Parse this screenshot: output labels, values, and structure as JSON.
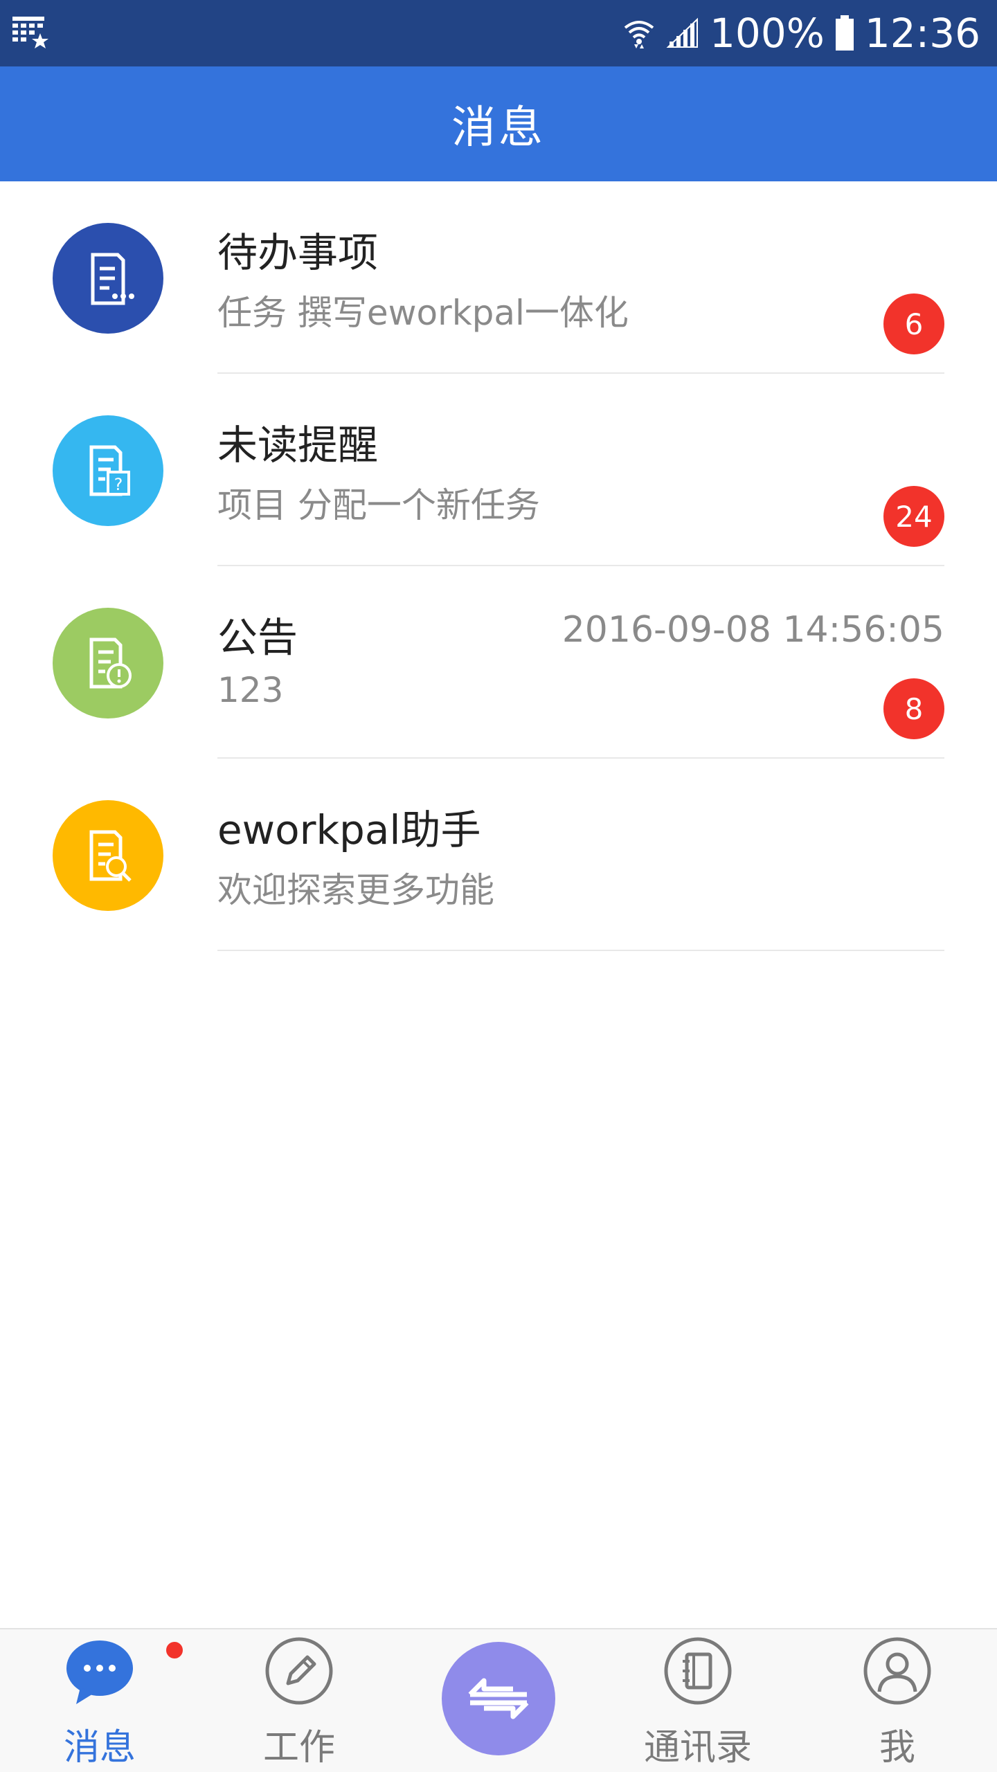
{
  "status_bar": {
    "battery": "100%",
    "time": "12:36"
  },
  "header": {
    "title": "消息"
  },
  "messages": [
    {
      "name": "待办事项",
      "preview": "任务 撰写eworkpal一体化",
      "time": "",
      "badge": "6",
      "color": "#2B4FAE",
      "icon": "document-more-icon"
    },
    {
      "name": "未读提醒",
      "preview": "项目 分配一个新任务",
      "time": "",
      "badge": "24",
      "color": "#35B7F0",
      "icon": "document-question-icon"
    },
    {
      "name": "公告",
      "preview": "123",
      "time": "2016-09-08 14:56:05",
      "badge": "8",
      "color": "#9CCB62",
      "icon": "document-alert-icon"
    },
    {
      "name": "eworkpal助手",
      "preview": "欢迎探索更多功能",
      "time": "",
      "badge": "",
      "color": "#FFB900",
      "icon": "document-search-icon"
    }
  ],
  "bottom_nav": {
    "items": [
      {
        "label": "消息",
        "icon": "chat-bubble-icon",
        "active": true
      },
      {
        "label": "工作",
        "icon": "pencil-icon",
        "active": false
      },
      {
        "label": "",
        "icon": "swap-arrows-icon",
        "active": false
      },
      {
        "label": "通讯录",
        "icon": "contacts-book-icon",
        "active": false
      },
      {
        "label": "我",
        "icon": "user-icon",
        "active": false
      }
    ]
  },
  "colors": {
    "status_bar": "#224485",
    "header": "#3473DC",
    "badge": "#F2332B",
    "center_button": "#8F8BEA"
  }
}
